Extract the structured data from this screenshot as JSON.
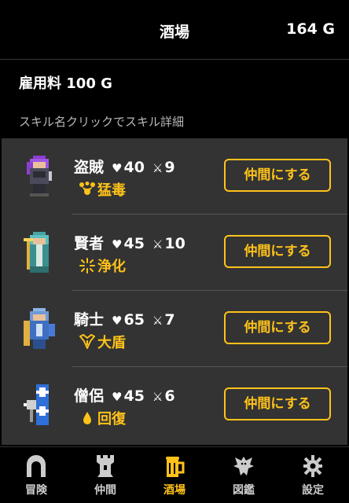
{
  "header": {
    "title": "酒場",
    "gold": "164 G"
  },
  "hire_fee": "雇用料 100 G",
  "hint": "スキル名クリックでスキル詳細",
  "symbols": {
    "heart": "♥",
    "sword": "⚔"
  },
  "recruits": [
    {
      "name": "盗賊",
      "hp": "40",
      "atk": "9",
      "skill": "猛毒",
      "skill_icon": "poison-icon",
      "button": "仲間にする"
    },
    {
      "name": "賢者",
      "hp": "45",
      "atk": "10",
      "skill": "浄化",
      "skill_icon": "sparkle-icon",
      "button": "仲間にする"
    },
    {
      "name": "騎士",
      "hp": "65",
      "atk": "7",
      "skill": "大盾",
      "skill_icon": "shield-crest-icon",
      "button": "仲間にする"
    },
    {
      "name": "僧侶",
      "hp": "45",
      "atk": "6",
      "skill": "回復",
      "skill_icon": "droplet-icon",
      "button": "仲間にする"
    }
  ],
  "nav": [
    {
      "label": "冒険",
      "icon": "gate-icon",
      "active": false
    },
    {
      "label": "仲間",
      "icon": "tower-icon",
      "active": false
    },
    {
      "label": "酒場",
      "icon": "beer-mug-icon",
      "active": true
    },
    {
      "label": "図鑑",
      "icon": "dragon-icon",
      "active": false
    },
    {
      "label": "設定",
      "icon": "gear-icon",
      "active": false
    }
  ],
  "colors": {
    "accent": "#ffc21a",
    "panel": "#333333",
    "background": "#000000"
  }
}
